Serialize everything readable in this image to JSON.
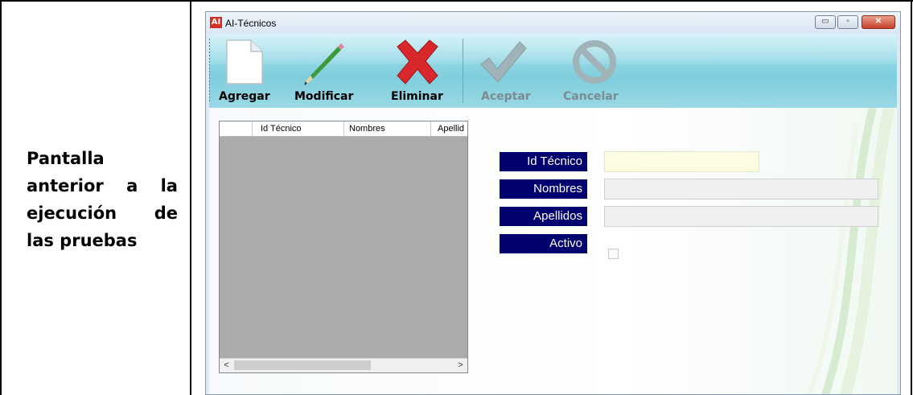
{
  "caption": {
    "lines": [
      [
        "Pantalla"
      ],
      [
        "anterior",
        "a",
        "la"
      ],
      [
        "ejecución",
        "de"
      ],
      [
        "las pruebas"
      ]
    ]
  },
  "window": {
    "icon_text": "AI",
    "title": "AI-Técnicos",
    "minimize": "▭",
    "maximize": "▫",
    "close": "✕"
  },
  "toolbar": {
    "agregar": "Agregar",
    "modificar": "Modificar",
    "eliminar": "Eliminar",
    "aceptar": "Aceptar",
    "cancelar": "Cancelar",
    "enabled_color": "#000000",
    "disabled_color": "#7a8c92"
  },
  "grid": {
    "columns": [
      "Id Técnico",
      "Nombres",
      "Apellid"
    ],
    "scroll_left": "<",
    "scroll_right": ">"
  },
  "form": {
    "id_tecnico_label": "Id Técnico",
    "nombres_label": "Nombres",
    "apellidos_label": "Apellidos",
    "activo_label": "Activo",
    "id_tecnico_value": "",
    "nombres_value": "",
    "apellidos_value": "",
    "activo_checked": false,
    "label_bg": "#00006e"
  }
}
